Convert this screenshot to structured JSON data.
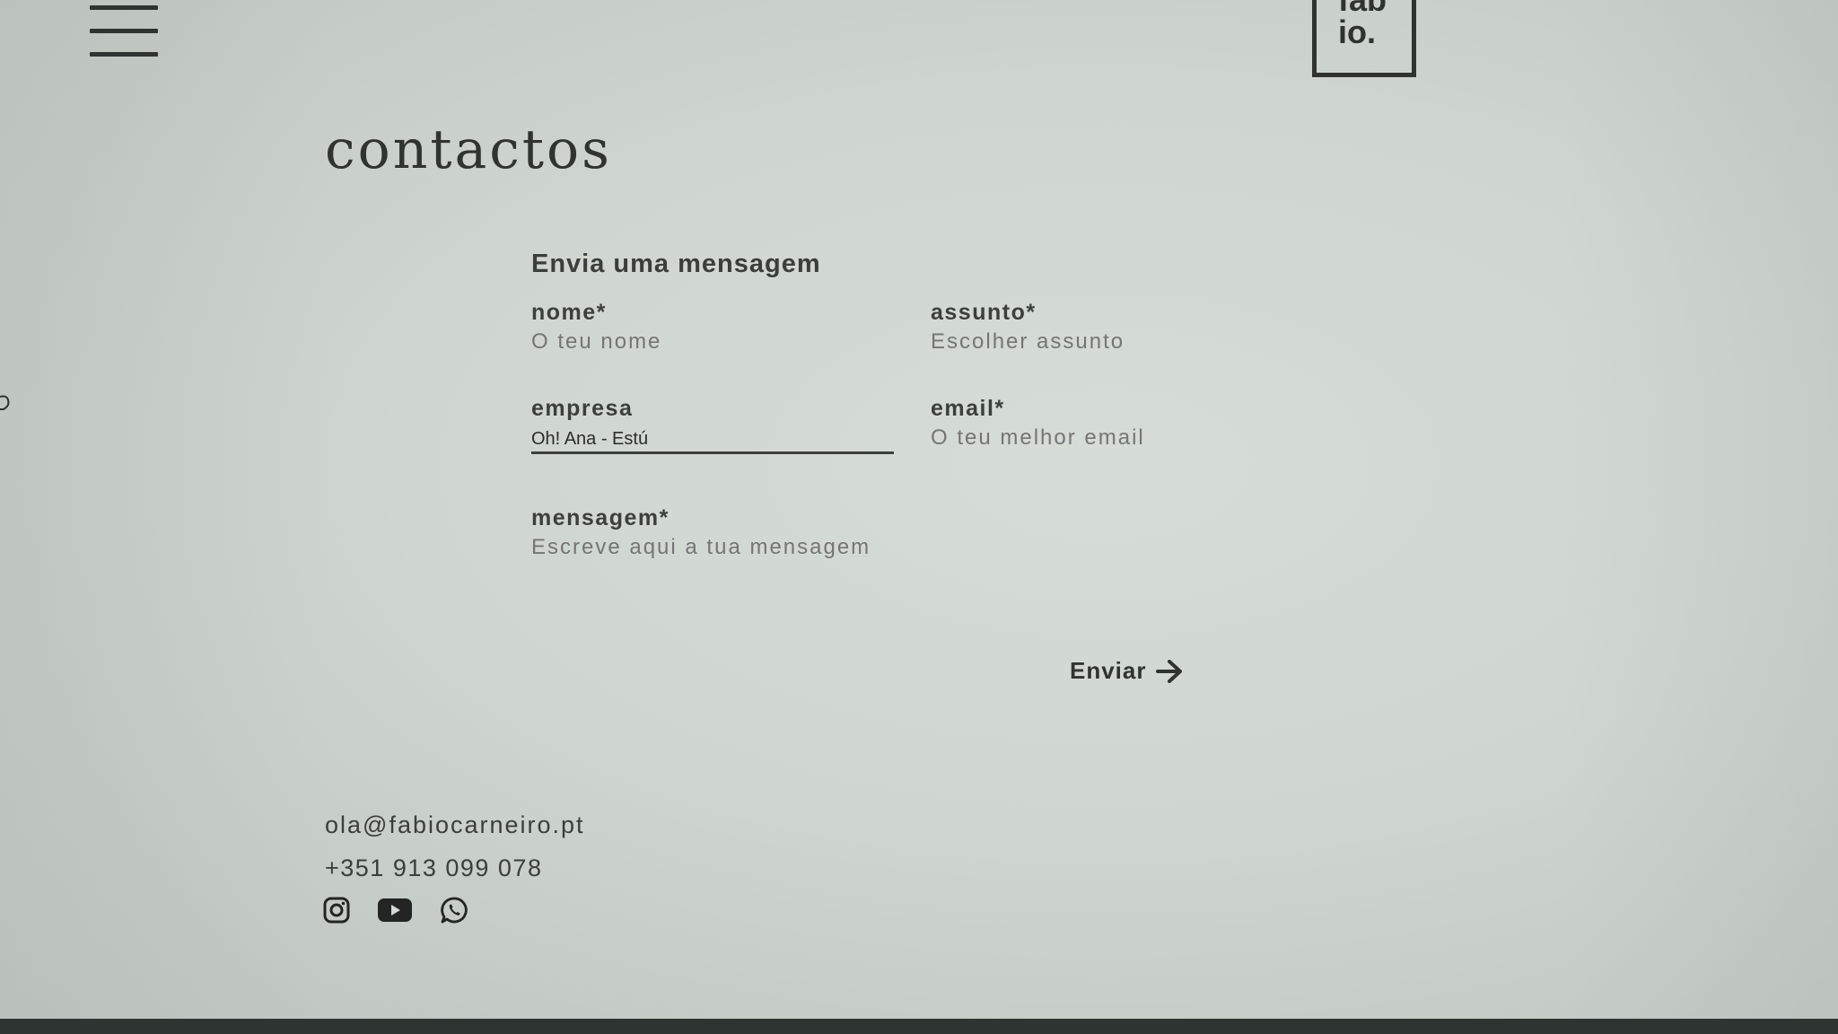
{
  "header": {
    "menu_icon": "hamburger-menu-icon",
    "logo_line1": "fab",
    "logo_line2": "io."
  },
  "page": {
    "title": "contactos"
  },
  "form": {
    "heading": "Envia uma mensagem",
    "fields": {
      "nome": {
        "label": "nome*",
        "placeholder": "O teu nome",
        "value": ""
      },
      "assunto": {
        "label": "assunto*",
        "placeholder": "Escolher assunto",
        "value": ""
      },
      "empresa": {
        "label": "empresa",
        "placeholder": "",
        "value": "Oh! Ana - Estú"
      },
      "email": {
        "label": "email*",
        "placeholder": "O teu melhor email",
        "value": ""
      },
      "mensagem": {
        "label": "mensagem*",
        "placeholder": "Escreve aqui a tua mensagem",
        "value": ""
      }
    },
    "submit_label": "Enviar",
    "submit_icon": "arrow-right-icon"
  },
  "contact": {
    "email": "ola@fabiocarneiro.pt",
    "phone": "+351 913 099 078",
    "social": [
      {
        "name": "instagram",
        "icon": "instagram-icon"
      },
      {
        "name": "youtube",
        "icon": "youtube-icon"
      },
      {
        "name": "whatsapp",
        "icon": "whatsapp-icon"
      }
    ]
  },
  "colors": {
    "background": "#d3d9d4",
    "text": "#2f3331",
    "placeholder": "#6d736f"
  }
}
